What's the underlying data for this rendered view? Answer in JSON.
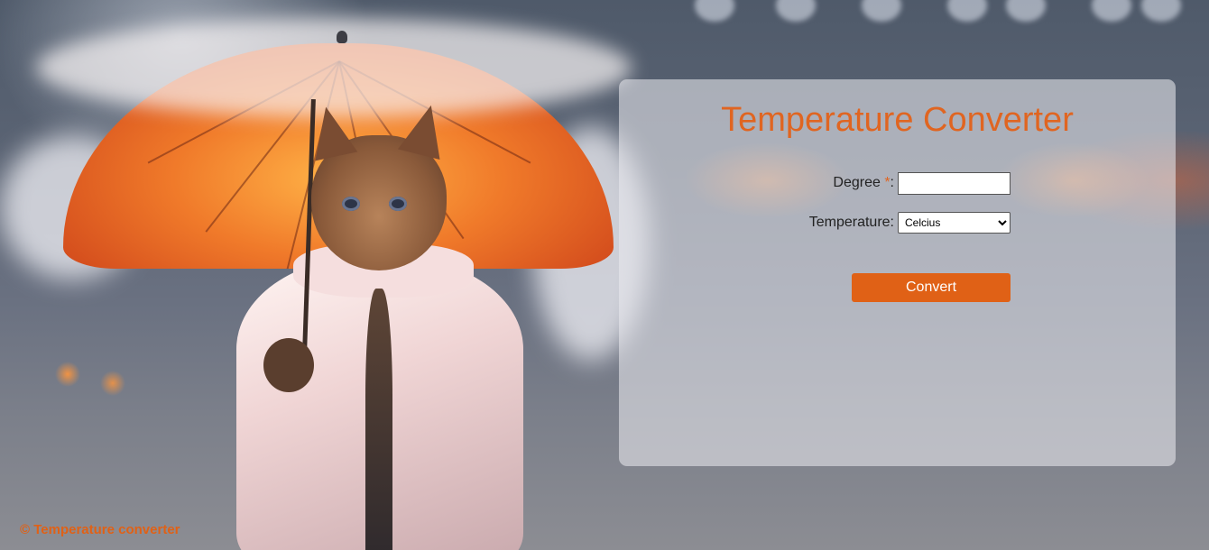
{
  "app": {
    "title": "Temperature Converter"
  },
  "form": {
    "degree_label": "Degree ",
    "required_marker": "*",
    "degree_colon": ":",
    "degree_value": "",
    "temperature_label": "Temperature:",
    "temperature_selected": "Celcius",
    "temperature_options": [
      "Celcius"
    ],
    "convert_label": "Convert"
  },
  "footer": {
    "text": "© Temperature converter"
  },
  "background": {
    "description_icon": "photo-cat-with-umbrella"
  },
  "colors": {
    "accent": "#e06521",
    "button": "#e06116",
    "panel_bg": "rgba(232,232,238,0.58)"
  }
}
